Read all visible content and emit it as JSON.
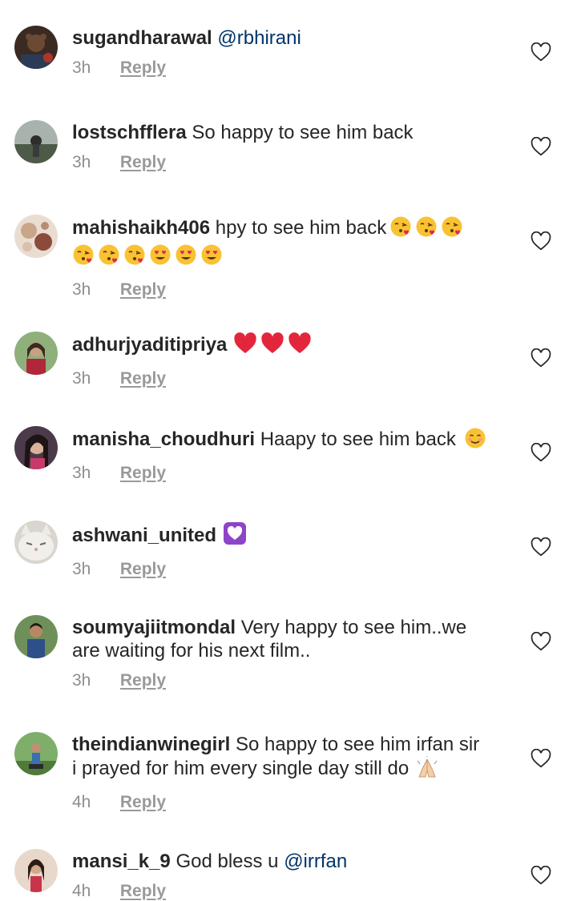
{
  "comments": [
    {
      "username": "sugandharawal",
      "mention": "@rbhirani",
      "text": "",
      "time": "3h",
      "reply": "Reply"
    },
    {
      "username": "lostschfflera",
      "text": "So happy to see him back",
      "time": "3h",
      "reply": "Reply"
    },
    {
      "username": "mahishaikh406",
      "text": "hpy to see him back",
      "emojis": [
        "kissing-heart",
        "kissing-heart",
        "kissing-heart",
        "kissing-heart",
        "kissing-heart",
        "kissing-heart",
        "heart-eyes",
        "heart-eyes",
        "heart-eyes"
      ],
      "time": "3h",
      "reply": "Reply"
    },
    {
      "username": "adhurjyaditipriya",
      "text": "",
      "emojis": [
        "red-heart",
        "red-heart",
        "red-heart"
      ],
      "time": "3h",
      "reply": "Reply"
    },
    {
      "username": "manisha_choudhuri",
      "text": "Haapy to see him back",
      "emojis": [
        "smiling-face"
      ],
      "time": "3h",
      "reply": "Reply"
    },
    {
      "username": "ashwani_united",
      "text": "",
      "emojis": [
        "purple-heart"
      ],
      "time": "3h",
      "reply": "Reply"
    },
    {
      "username": "soumyajiitmondal",
      "text": "Very happy to see him..we",
      "text_line2": "are waiting for his next film..",
      "time": "3h",
      "reply": "Reply"
    },
    {
      "username": "theindianwinegirl",
      "text": "So happy to see him irfan sir",
      "text_line2": "i prayed for him every single day still do",
      "emojis": [
        "folded-hands"
      ],
      "time": "4h",
      "reply": "Reply"
    },
    {
      "username": "mansi_k_9",
      "text": "God bless u",
      "mention": "@irrfan",
      "time": "4h",
      "reply": "Reply"
    }
  ],
  "colors": {
    "username": "#262626",
    "mention": "#003569",
    "meta": "#8e8e8e",
    "reply": "#999999"
  },
  "icons": {
    "like": "heart-outline-icon"
  }
}
